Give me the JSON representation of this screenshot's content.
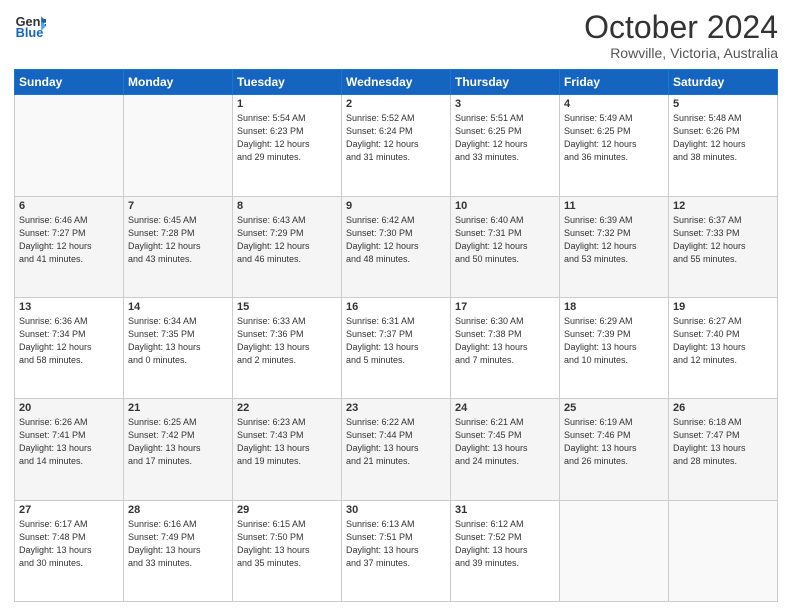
{
  "header": {
    "logo_line1": "General",
    "logo_line2": "Blue",
    "month": "October 2024",
    "location": "Rowville, Victoria, Australia"
  },
  "days_of_week": [
    "Sunday",
    "Monday",
    "Tuesday",
    "Wednesday",
    "Thursday",
    "Friday",
    "Saturday"
  ],
  "weeks": [
    [
      {
        "day": "",
        "info": ""
      },
      {
        "day": "",
        "info": ""
      },
      {
        "day": "1",
        "info": "Sunrise: 5:54 AM\nSunset: 6:23 PM\nDaylight: 12 hours\nand 29 minutes."
      },
      {
        "day": "2",
        "info": "Sunrise: 5:52 AM\nSunset: 6:24 PM\nDaylight: 12 hours\nand 31 minutes."
      },
      {
        "day": "3",
        "info": "Sunrise: 5:51 AM\nSunset: 6:25 PM\nDaylight: 12 hours\nand 33 minutes."
      },
      {
        "day": "4",
        "info": "Sunrise: 5:49 AM\nSunset: 6:25 PM\nDaylight: 12 hours\nand 36 minutes."
      },
      {
        "day": "5",
        "info": "Sunrise: 5:48 AM\nSunset: 6:26 PM\nDaylight: 12 hours\nand 38 minutes."
      }
    ],
    [
      {
        "day": "6",
        "info": "Sunrise: 6:46 AM\nSunset: 7:27 PM\nDaylight: 12 hours\nand 41 minutes."
      },
      {
        "day": "7",
        "info": "Sunrise: 6:45 AM\nSunset: 7:28 PM\nDaylight: 12 hours\nand 43 minutes."
      },
      {
        "day": "8",
        "info": "Sunrise: 6:43 AM\nSunset: 7:29 PM\nDaylight: 12 hours\nand 46 minutes."
      },
      {
        "day": "9",
        "info": "Sunrise: 6:42 AM\nSunset: 7:30 PM\nDaylight: 12 hours\nand 48 minutes."
      },
      {
        "day": "10",
        "info": "Sunrise: 6:40 AM\nSunset: 7:31 PM\nDaylight: 12 hours\nand 50 minutes."
      },
      {
        "day": "11",
        "info": "Sunrise: 6:39 AM\nSunset: 7:32 PM\nDaylight: 12 hours\nand 53 minutes."
      },
      {
        "day": "12",
        "info": "Sunrise: 6:37 AM\nSunset: 7:33 PM\nDaylight: 12 hours\nand 55 minutes."
      }
    ],
    [
      {
        "day": "13",
        "info": "Sunrise: 6:36 AM\nSunset: 7:34 PM\nDaylight: 12 hours\nand 58 minutes."
      },
      {
        "day": "14",
        "info": "Sunrise: 6:34 AM\nSunset: 7:35 PM\nDaylight: 13 hours\nand 0 minutes."
      },
      {
        "day": "15",
        "info": "Sunrise: 6:33 AM\nSunset: 7:36 PM\nDaylight: 13 hours\nand 2 minutes."
      },
      {
        "day": "16",
        "info": "Sunrise: 6:31 AM\nSunset: 7:37 PM\nDaylight: 13 hours\nand 5 minutes."
      },
      {
        "day": "17",
        "info": "Sunrise: 6:30 AM\nSunset: 7:38 PM\nDaylight: 13 hours\nand 7 minutes."
      },
      {
        "day": "18",
        "info": "Sunrise: 6:29 AM\nSunset: 7:39 PM\nDaylight: 13 hours\nand 10 minutes."
      },
      {
        "day": "19",
        "info": "Sunrise: 6:27 AM\nSunset: 7:40 PM\nDaylight: 13 hours\nand 12 minutes."
      }
    ],
    [
      {
        "day": "20",
        "info": "Sunrise: 6:26 AM\nSunset: 7:41 PM\nDaylight: 13 hours\nand 14 minutes."
      },
      {
        "day": "21",
        "info": "Sunrise: 6:25 AM\nSunset: 7:42 PM\nDaylight: 13 hours\nand 17 minutes."
      },
      {
        "day": "22",
        "info": "Sunrise: 6:23 AM\nSunset: 7:43 PM\nDaylight: 13 hours\nand 19 minutes."
      },
      {
        "day": "23",
        "info": "Sunrise: 6:22 AM\nSunset: 7:44 PM\nDaylight: 13 hours\nand 21 minutes."
      },
      {
        "day": "24",
        "info": "Sunrise: 6:21 AM\nSunset: 7:45 PM\nDaylight: 13 hours\nand 24 minutes."
      },
      {
        "day": "25",
        "info": "Sunrise: 6:19 AM\nSunset: 7:46 PM\nDaylight: 13 hours\nand 26 minutes."
      },
      {
        "day": "26",
        "info": "Sunrise: 6:18 AM\nSunset: 7:47 PM\nDaylight: 13 hours\nand 28 minutes."
      }
    ],
    [
      {
        "day": "27",
        "info": "Sunrise: 6:17 AM\nSunset: 7:48 PM\nDaylight: 13 hours\nand 30 minutes."
      },
      {
        "day": "28",
        "info": "Sunrise: 6:16 AM\nSunset: 7:49 PM\nDaylight: 13 hours\nand 33 minutes."
      },
      {
        "day": "29",
        "info": "Sunrise: 6:15 AM\nSunset: 7:50 PM\nDaylight: 13 hours\nand 35 minutes."
      },
      {
        "day": "30",
        "info": "Sunrise: 6:13 AM\nSunset: 7:51 PM\nDaylight: 13 hours\nand 37 minutes."
      },
      {
        "day": "31",
        "info": "Sunrise: 6:12 AM\nSunset: 7:52 PM\nDaylight: 13 hours\nand 39 minutes."
      },
      {
        "day": "",
        "info": ""
      },
      {
        "day": "",
        "info": ""
      }
    ]
  ]
}
